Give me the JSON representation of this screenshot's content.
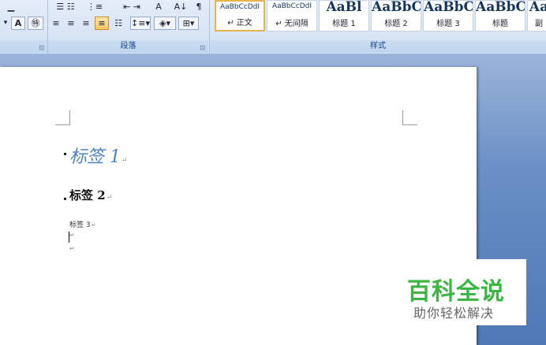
{
  "ribbon": {
    "paragraph_label": "段落",
    "styles_label": "样式",
    "font_buttons": [
      "A",
      "㊕"
    ],
    "launcher_glyph": "⊡",
    "styles": [
      {
        "sample": "AaBbCcDdI",
        "name": "↵ 正文",
        "size": "small",
        "active": true
      },
      {
        "sample": "AaBbCcDdI",
        "name": "↵ 无间隔",
        "size": "small",
        "active": false
      },
      {
        "sample": "AaBl",
        "name": "标题 1",
        "size": "big",
        "active": false
      },
      {
        "sample": "AaBbC",
        "name": "标题 2",
        "size": "big",
        "active": false
      },
      {
        "sample": "AaBbC",
        "name": "标题 3",
        "size": "big",
        "active": false
      },
      {
        "sample": "AaBbC",
        "name": "标题",
        "size": "big",
        "active": false
      },
      {
        "sample": "Aa",
        "name": "副",
        "size": "big",
        "active": false
      }
    ]
  },
  "document": {
    "heading1": "标签 1",
    "heading2": "标签 2",
    "heading3": "标签 3",
    "paragraph_mark": "↵"
  },
  "watermark": {
    "title": "百科全说",
    "subtitle": "助你轻松解决"
  },
  "colors": {
    "heading1": "#4f81bd",
    "accent_green": "#3cb545",
    "doc_background": "#5c84bf"
  }
}
